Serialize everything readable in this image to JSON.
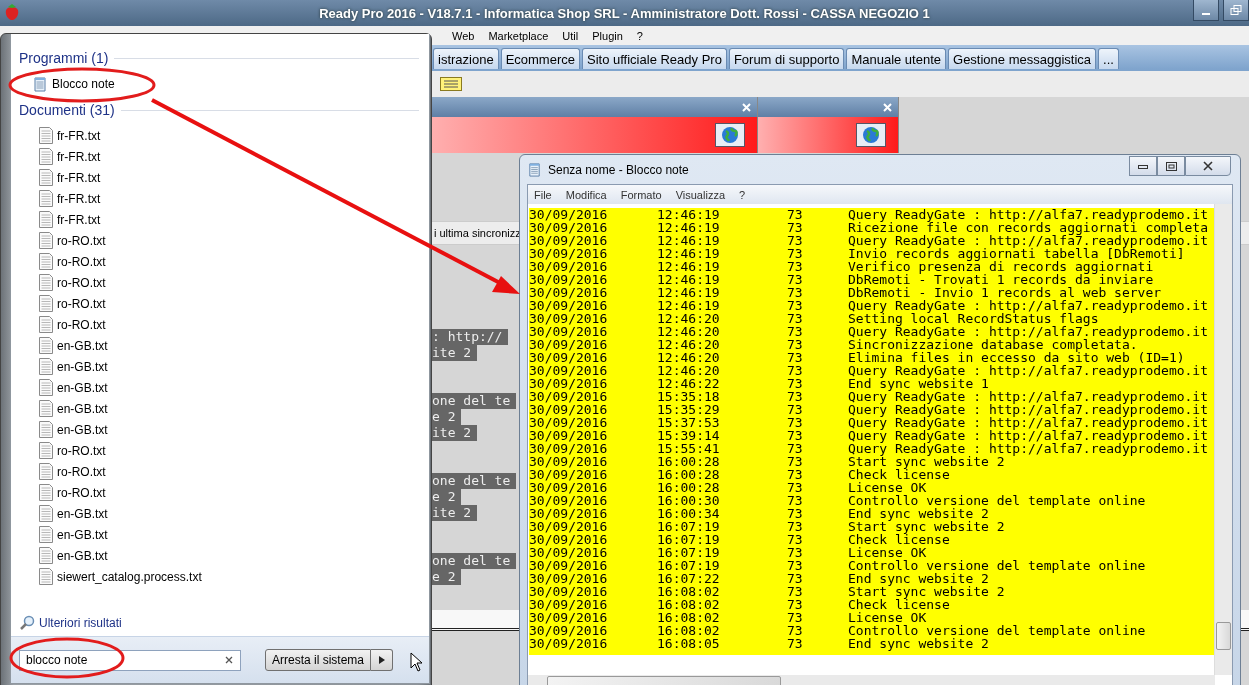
{
  "app": {
    "title": "Ready Pro 2016 - V18.7.1 - Informatica Shop SRL - Amministratore Dott. Rossi - CASSA NEGOZIO 1",
    "menu": [
      "Web",
      "Marketplace",
      "Util",
      "Plugin",
      "?"
    ],
    "tabs": [
      "istrazione",
      "Ecommerce",
      "Sito ufficiale Ready Pro",
      "Forum di supporto",
      "Manuale utente",
      "Gestione messaggistica",
      "..."
    ],
    "sync_label": "i ultima sincronizz",
    "log_fragments": [
      [
        ": http://",
        "ite 2"
      ],
      [
        "one del te",
        "e 2",
        "ite 2"
      ],
      [
        "one del te",
        "e 2",
        "ite 2"
      ],
      [
        "one del te",
        "e 2"
      ]
    ]
  },
  "start_menu": {
    "sections": [
      {
        "title": "Programmi (1)",
        "items": [
          {
            "label": "Blocco note",
            "kind": "app"
          }
        ]
      },
      {
        "title": "Documenti (31)",
        "items": [
          {
            "label": "fr-FR.txt",
            "kind": "doc"
          },
          {
            "label": "fr-FR.txt",
            "kind": "doc"
          },
          {
            "label": "fr-FR.txt",
            "kind": "doc"
          },
          {
            "label": "fr-FR.txt",
            "kind": "doc"
          },
          {
            "label": "fr-FR.txt",
            "kind": "doc"
          },
          {
            "label": "ro-RO.txt",
            "kind": "doc"
          },
          {
            "label": "ro-RO.txt",
            "kind": "doc"
          },
          {
            "label": "ro-RO.txt",
            "kind": "doc"
          },
          {
            "label": "ro-RO.txt",
            "kind": "doc"
          },
          {
            "label": "ro-RO.txt",
            "kind": "doc"
          },
          {
            "label": "en-GB.txt",
            "kind": "doc"
          },
          {
            "label": "en-GB.txt",
            "kind": "doc"
          },
          {
            "label": "en-GB.txt",
            "kind": "doc"
          },
          {
            "label": "en-GB.txt",
            "kind": "doc"
          },
          {
            "label": "en-GB.txt",
            "kind": "doc"
          },
          {
            "label": "ro-RO.txt",
            "kind": "doc"
          },
          {
            "label": "ro-RO.txt",
            "kind": "doc"
          },
          {
            "label": "ro-RO.txt",
            "kind": "doc"
          },
          {
            "label": "en-GB.txt",
            "kind": "doc"
          },
          {
            "label": "en-GB.txt",
            "kind": "doc"
          },
          {
            "label": "en-GB.txt",
            "kind": "doc"
          },
          {
            "label": "siewert_catalog.process.txt",
            "kind": "doc"
          }
        ]
      }
    ],
    "more_results": "Ulteriori risultati",
    "search": {
      "value": "blocco note"
    },
    "shutdown": "Arresta il sistema"
  },
  "notepad": {
    "title": "Senza nome - Blocco note",
    "menu": [
      "File",
      "Modifica",
      "Formato",
      "Visualizza",
      "?"
    ],
    "lines": [
      {
        "date": "30/09/2016",
        "time": "12:46:19",
        "code": "73",
        "message": "Query ReadyGate : http://alfa7.readyprodemo.it"
      },
      {
        "date": "30/09/2016",
        "time": "12:46:19",
        "code": "73",
        "message": "Ricezione file con records aggiornati completa"
      },
      {
        "date": "30/09/2016",
        "time": "12:46:19",
        "code": "73",
        "message": "Query ReadyGate : http://alfa7.readyprodemo.it"
      },
      {
        "date": "30/09/2016",
        "time": "12:46:19",
        "code": "73",
        "message": "Invio records aggiornati tabella [DbRemoti]"
      },
      {
        "date": "30/09/2016",
        "time": "12:46:19",
        "code": "73",
        "message": "Verifico presenza di records aggiornati"
      },
      {
        "date": "30/09/2016",
        "time": "12:46:19",
        "code": "73",
        "message": "DbRemoti - Trovati 1 records da inviare"
      },
      {
        "date": "30/09/2016",
        "time": "12:46:19",
        "code": "73",
        "message": "DbRemoti - Invio 1 records al web server"
      },
      {
        "date": "30/09/2016",
        "time": "12:46:19",
        "code": "73",
        "message": "Query ReadyGate : http://alfa7.readyprodemo.it"
      },
      {
        "date": "30/09/2016",
        "time": "12:46:20",
        "code": "73",
        "message": "Setting local RecordStatus flags"
      },
      {
        "date": "30/09/2016",
        "time": "12:46:20",
        "code": "73",
        "message": "Query ReadyGate : http://alfa7.readyprodemo.it"
      },
      {
        "date": "30/09/2016",
        "time": "12:46:20",
        "code": "73",
        "message": "Sincronizzazione database completata."
      },
      {
        "date": "30/09/2016",
        "time": "12:46:20",
        "code": "73",
        "message": "Elimina files in eccesso da sito web (ID=1)"
      },
      {
        "date": "30/09/2016",
        "time": "12:46:20",
        "code": "73",
        "message": "Query ReadyGate : http://alfa7.readyprodemo.it"
      },
      {
        "date": "30/09/2016",
        "time": "12:46:22",
        "code": "73",
        "message": "End sync website 1"
      },
      {
        "date": "30/09/2016",
        "time": "15:35:18",
        "code": "73",
        "message": "Query ReadyGate : http://alfa7.readyprodemo.it"
      },
      {
        "date": "30/09/2016",
        "time": "15:35:29",
        "code": "73",
        "message": "Query ReadyGate : http://alfa7.readyprodemo.it"
      },
      {
        "date": "30/09/2016",
        "time": "15:37:53",
        "code": "73",
        "message": "Query ReadyGate : http://alfa7.readyprodemo.it"
      },
      {
        "date": "30/09/2016",
        "time": "15:39:14",
        "code": "73",
        "message": "Query ReadyGate : http://alfa7.readyprodemo.it"
      },
      {
        "date": "30/09/2016",
        "time": "15:55:41",
        "code": "73",
        "message": "Query ReadyGate : http://alfa7.readyprodemo.it"
      },
      {
        "date": "30/09/2016",
        "time": "16:00:28",
        "code": "73",
        "message": "Start sync website 2"
      },
      {
        "date": "30/09/2016",
        "time": "16:00:28",
        "code": "73",
        "message": "Check license"
      },
      {
        "date": "30/09/2016",
        "time": "16:00:28",
        "code": "73",
        "message": "License OK"
      },
      {
        "date": "30/09/2016",
        "time": "16:00:30",
        "code": "73",
        "message": "Controllo versione del template online"
      },
      {
        "date": "30/09/2016",
        "time": "16:00:34",
        "code": "73",
        "message": "End sync website 2"
      },
      {
        "date": "30/09/2016",
        "time": "16:07:19",
        "code": "73",
        "message": "Start sync website 2"
      },
      {
        "date": "30/09/2016",
        "time": "16:07:19",
        "code": "73",
        "message": "Check license"
      },
      {
        "date": "30/09/2016",
        "time": "16:07:19",
        "code": "73",
        "message": "License OK"
      },
      {
        "date": "30/09/2016",
        "time": "16:07:19",
        "code": "73",
        "message": "Controllo versione del template online"
      },
      {
        "date": "30/09/2016",
        "time": "16:07:22",
        "code": "73",
        "message": "End sync website 2"
      },
      {
        "date": "30/09/2016",
        "time": "16:08:02",
        "code": "73",
        "message": "Start sync website 2"
      },
      {
        "date": "30/09/2016",
        "time": "16:08:02",
        "code": "73",
        "message": "Check license"
      },
      {
        "date": "30/09/2016",
        "time": "16:08:02",
        "code": "73",
        "message": "License OK"
      },
      {
        "date": "30/09/2016",
        "time": "16:08:02",
        "code": "73",
        "message": "Controllo versione del template online"
      },
      {
        "date": "30/09/2016",
        "time": "16:08:05",
        "code": "73",
        "message": "End sync website 2"
      }
    ]
  }
}
